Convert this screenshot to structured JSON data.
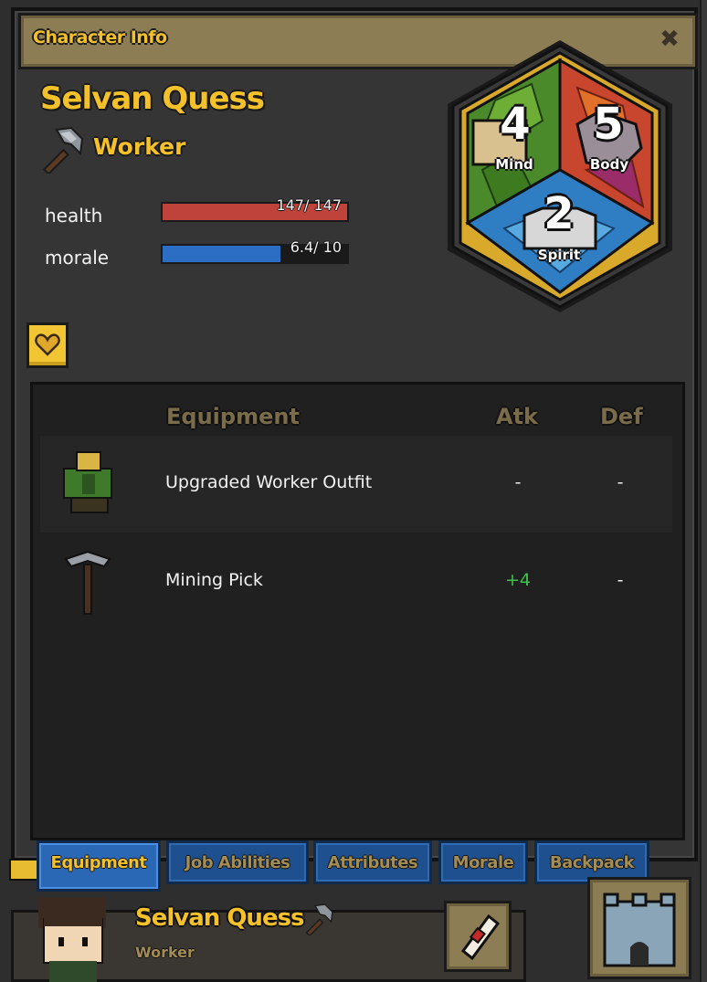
{
  "window": {
    "title": "Character Info",
    "close_label": "✖"
  },
  "character": {
    "name": "Selvan Quess",
    "job": "Worker",
    "job_icon": "hammer-icon"
  },
  "stats": {
    "health": {
      "label": "health",
      "text": "147/ 147",
      "fraction": 1.0,
      "color": "#c0433b"
    },
    "morale": {
      "label": "morale",
      "text": "6.4/ 10",
      "fraction": 0.64,
      "color": "#2b6ec4"
    }
  },
  "attributes": {
    "mind": {
      "label": "Mind",
      "value": "4"
    },
    "body": {
      "label": "Body",
      "value": "5"
    },
    "spirit": {
      "label": "Spirit",
      "value": "2"
    }
  },
  "favorite_button": {
    "icon": "heart-icon"
  },
  "equipment_table": {
    "headers": {
      "name": "Equipment",
      "atk": "Atk",
      "def": "Def"
    },
    "rows": [
      {
        "icon": "outfit-icon",
        "name": "Upgraded Worker Outfit",
        "atk": "-",
        "def": "-"
      },
      {
        "icon": "pickaxe-icon",
        "name": "Mining Pick",
        "atk": "+4",
        "def": "-"
      }
    ]
  },
  "tabs": [
    {
      "label": "Equipment",
      "active": true
    },
    {
      "label": "Job Abilities",
      "active": false
    },
    {
      "label": "Attributes",
      "active": false
    },
    {
      "label": "Morale",
      "active": false
    },
    {
      "label": "Backpack",
      "active": false
    }
  ],
  "footer": {
    "name": "Selvan Quess",
    "job": "Worker",
    "scroll_icon": "scroll-icon",
    "castle_icon": "castle-icon"
  },
  "colors": {
    "gold": "#f5c12a",
    "tab_blue": "#1e4f8e",
    "tab_active_blue": "#2a67b5",
    "atk_green": "#3fc24c"
  }
}
